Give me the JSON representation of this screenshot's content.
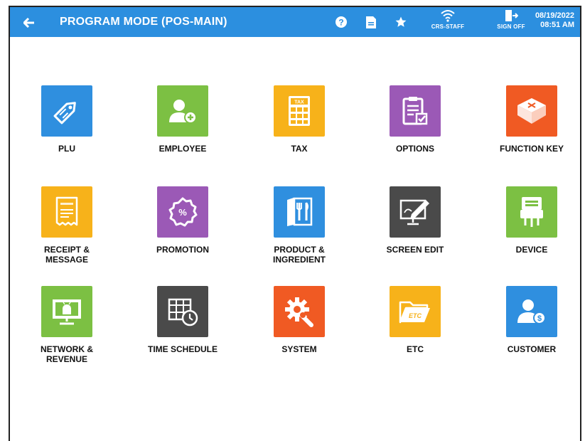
{
  "header": {
    "title": "PROGRAM MODE (POS-MAIN)",
    "wifi_label": "CRS-STAFF",
    "signoff_label": "SIGN OFF",
    "date": "08/19/2022",
    "time": "08:51 AM",
    "bar_color": "#2c8fdf"
  },
  "tiles": [
    {
      "label": "PLU",
      "icon": "price-tag-icon",
      "color": "#2f8fdf"
    },
    {
      "label": "EMPLOYEE",
      "icon": "add-person-icon",
      "color": "#7cc043"
    },
    {
      "label": "TAX",
      "icon": "tax-calculator-icon",
      "color": "#f7b21a"
    },
    {
      "label": "OPTIONS",
      "icon": "clipboard-check-icon",
      "color": "#9b59b6"
    },
    {
      "label": "FUNCTION KEY",
      "icon": "keycap-icon",
      "color": "#f05a23"
    },
    {
      "label": "RECEIPT &\nMESSAGE",
      "icon": "receipt-icon",
      "color": "#f7b21a"
    },
    {
      "label": "PROMOTION",
      "icon": "percent-badge-icon",
      "color": "#9b59b6"
    },
    {
      "label": "PRODUCT &\nINGREDIENT",
      "icon": "recipe-book-icon",
      "color": "#2f8fdf"
    },
    {
      "label": "SCREEN EDIT",
      "icon": "monitor-pen-icon",
      "color": "#4a4a4a"
    },
    {
      "label": "DEVICE",
      "icon": "device-connector-icon",
      "color": "#7cc043"
    },
    {
      "label": "NETWORK &\nREVENUE",
      "icon": "android-monitor-icon",
      "color": "#7cc043"
    },
    {
      "label": "TIME SCHEDULE",
      "icon": "calendar-clock-icon",
      "color": "#4a4a4a"
    },
    {
      "label": "SYSTEM",
      "icon": "gear-wrench-icon",
      "color": "#f05a23"
    },
    {
      "label": "ETC",
      "icon": "folder-icon",
      "color": "#f7b21a"
    },
    {
      "label": "CUSTOMER",
      "icon": "customer-dollar-icon",
      "color": "#2f8fdf"
    }
  ]
}
